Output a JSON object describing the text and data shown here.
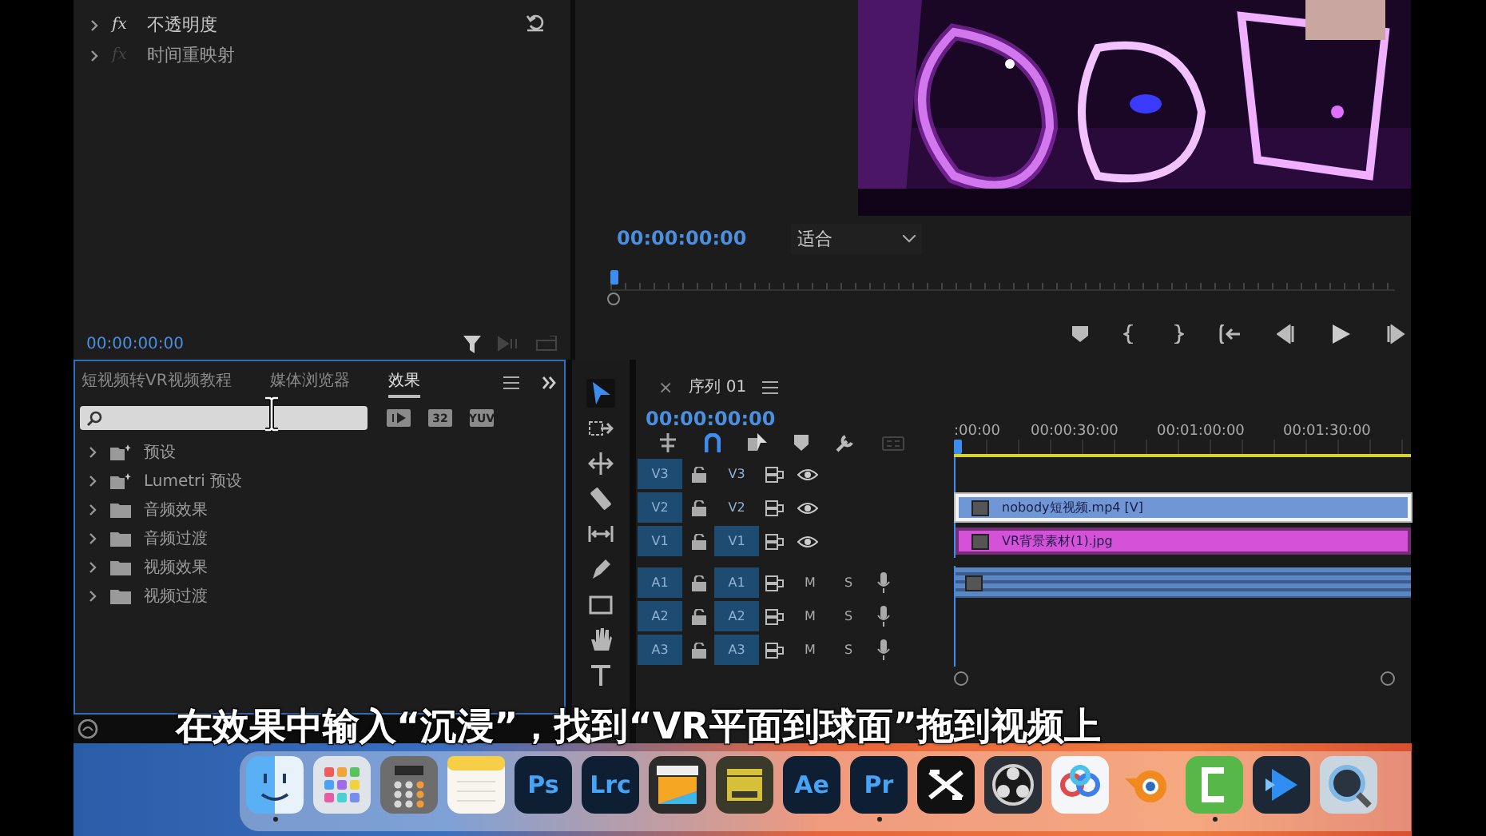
{
  "effect_controls": {
    "rows": [
      {
        "badge": "fx",
        "label": "不透明度",
        "enabled": true
      },
      {
        "badge": "fx",
        "label": "时间重映射",
        "enabled": false
      }
    ],
    "timecode": "00:00:00:00"
  },
  "monitor": {
    "timecode": "00:00:00:00",
    "zoom": "适合",
    "level": 0
  },
  "effects_panel": {
    "tabs": [
      {
        "label": "短视频转VR视频教程",
        "selected": false
      },
      {
        "label": "媒体浏览器",
        "selected": false
      },
      {
        "label": "效果",
        "selected": true
      }
    ],
    "filters": [
      {
        "kind": "accel"
      },
      {
        "kind": "text",
        "label": "32"
      },
      {
        "kind": "text",
        "label": "YUV"
      }
    ],
    "items": [
      {
        "kind": "preset",
        "label": "预设",
        "expanded": false
      },
      {
        "kind": "preset",
        "label": "Lumetri 预设",
        "expanded": false
      },
      {
        "kind": "folder",
        "label": "音频效果",
        "expanded": false
      },
      {
        "kind": "folder",
        "label": "音频过渡",
        "expanded": false
      },
      {
        "kind": "folder",
        "label": "视频效果",
        "expanded": false
      },
      {
        "kind": "folder",
        "label": "视频过渡",
        "expanded": false
      }
    ]
  },
  "tools": [
    {
      "kind": "select",
      "selected": true
    },
    {
      "kind": "track",
      "selected": false
    },
    {
      "kind": "ripple",
      "selected": false
    },
    {
      "kind": "razor",
      "selected": false
    },
    {
      "kind": "slip",
      "selected": false
    },
    {
      "kind": "pen",
      "selected": false
    },
    {
      "kind": "rect",
      "selected": false
    },
    {
      "kind": "hand",
      "selected": false
    },
    {
      "kind": "type",
      "selected": false
    }
  ],
  "timeline": {
    "close": "×",
    "title": "序列 01",
    "timecode": "00:00:00:00",
    "ruler": [
      ":00:00",
      "00:00:30:00",
      "00:01:00:00",
      "00:01:30:00"
    ],
    "tracks": [
      {
        "kind": "video",
        "source": "V3",
        "target": "V3",
        "targeted": false
      },
      {
        "kind": "video",
        "source": "V2",
        "target": "V2",
        "targeted": false,
        "clip": {
          "kind": "video",
          "label": "nobody短视频.mp4 [V]",
          "color": "#6f97d6",
          "selected": true
        }
      },
      {
        "kind": "video",
        "source": "V1",
        "target": "V1",
        "targeted": true,
        "clip": {
          "kind": "video",
          "label": "VR背景素材(1).jpg",
          "color": "#d552d8",
          "selected": false
        }
      },
      {
        "kind": "audio",
        "source": "A1",
        "target": "A1",
        "targeted": true,
        "mute": "M",
        "solo": "S",
        "clip": {
          "kind": "audio",
          "color": "#5b86c4"
        }
      },
      {
        "kind": "audio",
        "source": "A2",
        "target": "A2",
        "targeted": true,
        "mute": "M",
        "solo": "S"
      },
      {
        "kind": "audio",
        "source": "A3",
        "target": "A3",
        "targeted": true,
        "mute": "M",
        "solo": "S"
      }
    ]
  },
  "subtitle": "在效果中输入“沉浸”，找到“VR平面到球面”拖到视频上",
  "dock": {
    "items": [
      {
        "kind": "finder",
        "running": true
      },
      {
        "kind": "launchpad",
        "running": false
      },
      {
        "kind": "calculator",
        "running": false
      },
      {
        "kind": "notes",
        "running": false
      },
      {
        "kind": "label",
        "label": "Ps",
        "running": false
      },
      {
        "kind": "label",
        "label": "Lrc",
        "running": false
      },
      {
        "kind": "finalcut",
        "running": false
      },
      {
        "kind": "clapper",
        "running": false
      },
      {
        "kind": "label",
        "label": "Ae",
        "running": false
      },
      {
        "kind": "label",
        "label": "Pr",
        "running": true
      },
      {
        "kind": "capcut",
        "running": false
      },
      {
        "kind": "obs",
        "running": false
      },
      {
        "kind": "cloud",
        "running": false
      },
      {
        "kind": "blender",
        "running": false
      },
      {
        "kind": "camtasia",
        "running": true
      },
      {
        "kind": "player",
        "running": false
      },
      {
        "kind": "quicktime",
        "running": false
      }
    ]
  }
}
